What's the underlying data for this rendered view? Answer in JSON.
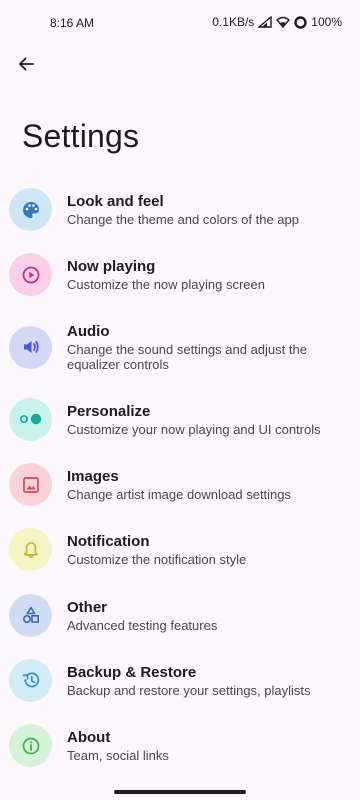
{
  "status_bar": {
    "time": "8:16 AM",
    "net_speed": "0.1KB/s",
    "battery": "100%"
  },
  "header": {
    "back_icon": "arrow-left-icon",
    "title": "Settings"
  },
  "settings": [
    {
      "title": "Look and feel",
      "subtitle": "Change the theme and colors of the app",
      "icon": "palette-icon",
      "bg": "#cfe6f7",
      "fg": "#2f7bbf"
    },
    {
      "title": "Now playing",
      "subtitle": "Customize the now playing screen",
      "icon": "play-circle-icon",
      "bg": "#f9cfe9",
      "fg": "#c2338c"
    },
    {
      "title": "Audio",
      "subtitle": "Change the sound settings and adjust the equalizer controls",
      "icon": "volume-icon",
      "bg": "#d4d8f7",
      "fg": "#4a56c9"
    },
    {
      "title": "Personalize",
      "subtitle": "Customize your now playing and UI controls",
      "icon": "toggle-icon",
      "bg": "#c9f1ee",
      "fg": "#1aa89c"
    },
    {
      "title": "Images",
      "subtitle": "Change artist image download settings",
      "icon": "image-icon",
      "bg": "#f9d3d9",
      "fg": "#d0485c"
    },
    {
      "title": "Notification",
      "subtitle": "Customize the notification style",
      "icon": "bell-icon",
      "bg": "#f6f4c4",
      "fg": "#c9b421"
    },
    {
      "title": "Other",
      "subtitle": "Advanced testing features",
      "icon": "shapes-icon",
      "bg": "#cfdcf3",
      "fg": "#3e69b7"
    },
    {
      "title": "Backup & Restore",
      "subtitle": "Backup and restore your settings, playlists",
      "icon": "restore-icon",
      "bg": "#d2ecf7",
      "fg": "#2d8fbf"
    },
    {
      "title": "About",
      "subtitle": "Team, social links",
      "icon": "info-icon",
      "bg": "#d4f3d9",
      "fg": "#3fae57"
    }
  ]
}
